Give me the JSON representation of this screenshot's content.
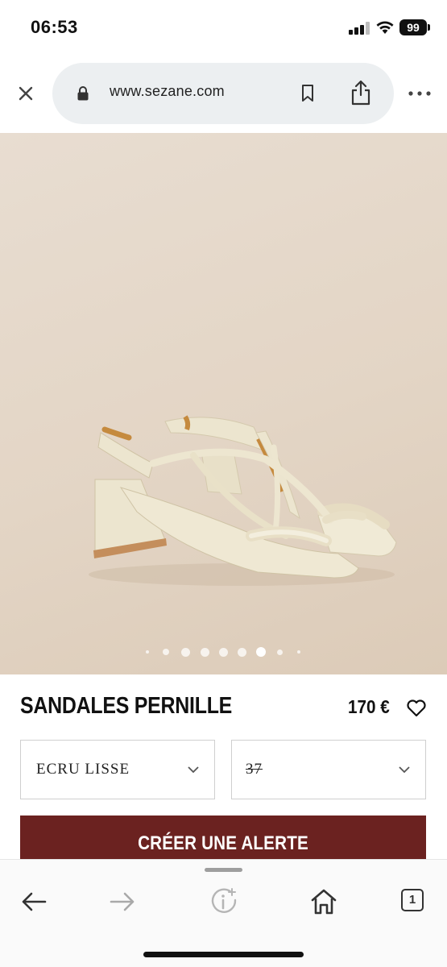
{
  "status_bar": {
    "time": "06:53",
    "battery": "99"
  },
  "browser": {
    "url": "www.sezane.com"
  },
  "carousel": {
    "dot_count": 9,
    "active_index": 6
  },
  "product": {
    "name": "SANDALES PERNILLE",
    "price": "170 €",
    "color_select": "ECRU LISSE",
    "size_select": "37",
    "alert_button": "CRÉER UNE ALERTE"
  },
  "toolbar": {
    "tab_count": "1"
  },
  "colors": {
    "accent": "#6b2220",
    "image_background": "#e3d5c5"
  }
}
